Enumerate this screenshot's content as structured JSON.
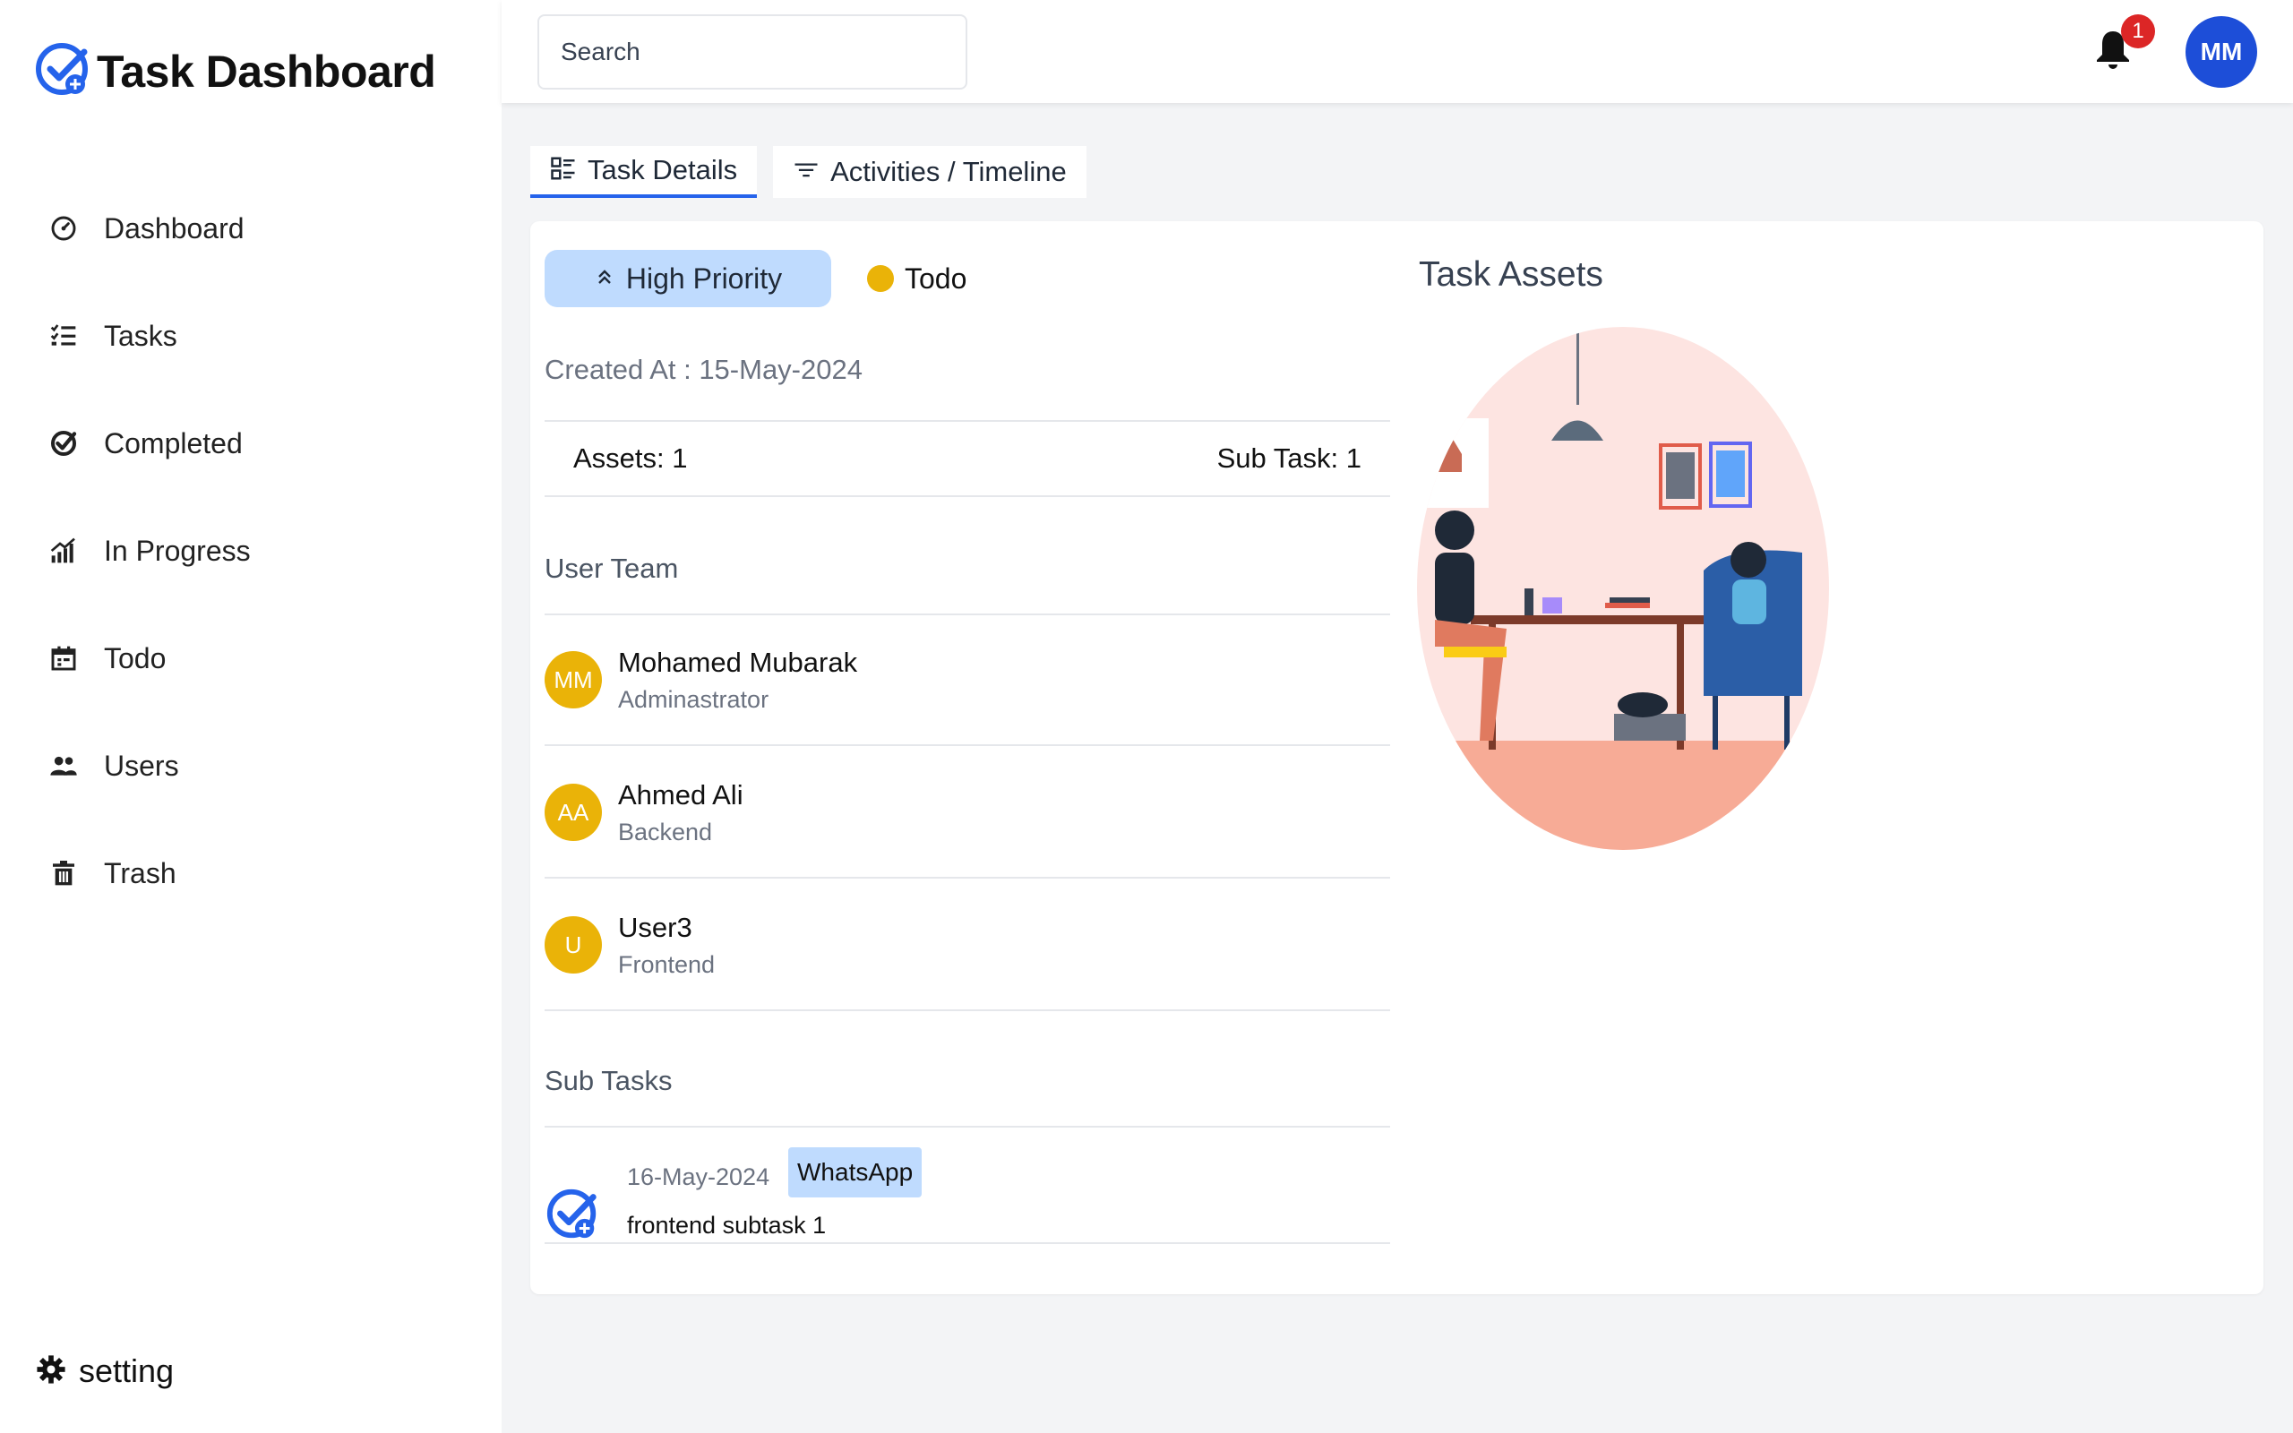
{
  "app": {
    "title": "Task Dashboard"
  },
  "sidebar": {
    "items": [
      {
        "label": "Dashboard",
        "icon": "dashboard-icon"
      },
      {
        "label": "Tasks",
        "icon": "tasks-icon"
      },
      {
        "label": "Completed",
        "icon": "completed-icon"
      },
      {
        "label": "In Progress",
        "icon": "in-progress-icon"
      },
      {
        "label": "Todo",
        "icon": "todo-icon"
      },
      {
        "label": "Users",
        "icon": "users-icon"
      },
      {
        "label": "Trash",
        "icon": "trash-icon"
      }
    ],
    "setting_label": "setting"
  },
  "header": {
    "search_placeholder": "Search",
    "notification_count": "1",
    "user_initials": "MM"
  },
  "tabs": [
    {
      "label": "Task Details",
      "active": true
    },
    {
      "label": "Activities / Timeline",
      "active": false
    }
  ],
  "task": {
    "priority": "High Priority",
    "status": "Todo",
    "created_at": "Created At : 15-May-2024",
    "assets_count": "Assets:  1",
    "subtask_count": "Sub Task:  1",
    "team_title": "User Team",
    "team": [
      {
        "initials": "MM",
        "name": "Mohamed Mubarak",
        "role": "Adminastrator"
      },
      {
        "initials": "AA",
        "name": "Ahmed Ali",
        "role": "Backend"
      },
      {
        "initials": "U",
        "name": "User3",
        "role": "Frontend"
      }
    ],
    "subtasks_title": "Sub Tasks",
    "subtasks": [
      {
        "date": "16-May-2024",
        "tag": "WhatsApp",
        "title": "frontend subtask 1"
      }
    ],
    "assets_title": "Task Assets"
  },
  "colors": {
    "brand_blue": "#2563eb",
    "priority_bg": "#bfdbfe",
    "status_yellow": "#eab308",
    "badge_red": "#dc2626"
  }
}
